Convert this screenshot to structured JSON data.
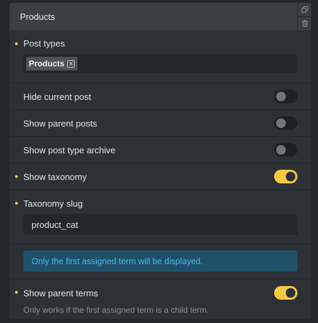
{
  "panel": {
    "title": "Products",
    "actions": [
      {
        "name": "duplicate-icon"
      },
      {
        "name": "trash-icon"
      }
    ]
  },
  "fields": {
    "post_types": {
      "label": "Post types",
      "tags": [
        "Products"
      ],
      "remove_glyph": "×"
    },
    "hide_current_post": {
      "label": "Hide current post",
      "enabled": false
    },
    "show_parent_posts": {
      "label": "Show parent posts",
      "enabled": false
    },
    "show_post_type_archive": {
      "label": "Show post type archive",
      "enabled": false
    },
    "show_taxonomy": {
      "label": "Show taxonomy",
      "enabled": true
    },
    "taxonomy_slug": {
      "label": "Taxonomy slug",
      "value": "product_cat"
    },
    "notice": "Only the first assigned term will be displayed.",
    "show_parent_terms": {
      "label": "Show parent terms",
      "enabled": true,
      "helper": "Only works if the first assigned term is a child term."
    }
  },
  "colors": {
    "accent": "#f5c842",
    "info_text": "#4bb8ec",
    "info_bg": "#1f5069",
    "panel_bg": "#2d3136",
    "header_bg": "#3a3f46"
  }
}
